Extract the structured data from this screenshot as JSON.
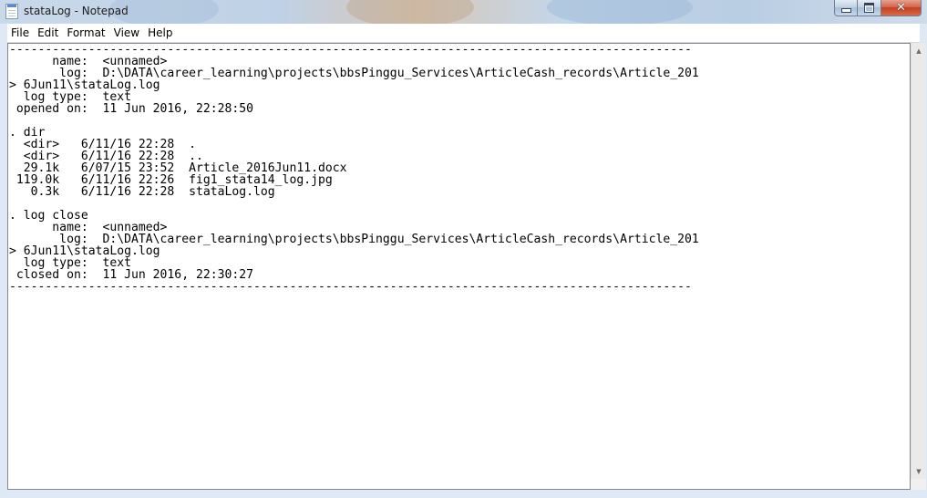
{
  "window": {
    "title": "stataLog - Notepad",
    "icon": "notepad-icon"
  },
  "caption_buttons": {
    "minimize_icon": "minimize-icon",
    "maximize_icon": "maximize-icon",
    "close_icon": "close-icon",
    "close_glyph": "✕"
  },
  "menu": {
    "items": [
      "File",
      "Edit",
      "Format",
      "View",
      "Help"
    ]
  },
  "editor": {
    "lines": [
      "-----------------------------------------------------------------------------------------------",
      "      name:  <unnamed>",
      "       log:  D:\\DATA\\career_learning\\projects\\bbsPinggu_Services\\ArticleCash_records\\Article_201",
      "> 6Jun11\\stataLog.log",
      "  log type:  text",
      " opened on:  11 Jun 2016, 22:28:50",
      "",
      ". dir",
      "  <dir>   6/11/16 22:28  .",
      "  <dir>   6/11/16 22:28  ..",
      "  29.1k   6/07/15 23:52  Article_2016Jun11.docx",
      " 119.0k   6/11/16 22:26  fig1_stata14_log.jpg",
      "   0.3k   6/11/16 22:28  stataLog.log",
      "",
      ". log close",
      "      name:  <unnamed>",
      "       log:  D:\\DATA\\career_learning\\projects\\bbsPinggu_Services\\ArticleCash_records\\Article_201",
      "> 6Jun11\\stataLog.log",
      "  log type:  text",
      " closed on:  11 Jun 2016, 22:30:27",
      "-----------------------------------------------------------------------------------------------"
    ]
  },
  "scrollbar": {
    "up_arrow": "▲",
    "down_arrow": "▼"
  },
  "colors": {
    "close_button": "#c2401f",
    "window_frame": "#dfe9f5",
    "editor_background": "#ffffff"
  }
}
